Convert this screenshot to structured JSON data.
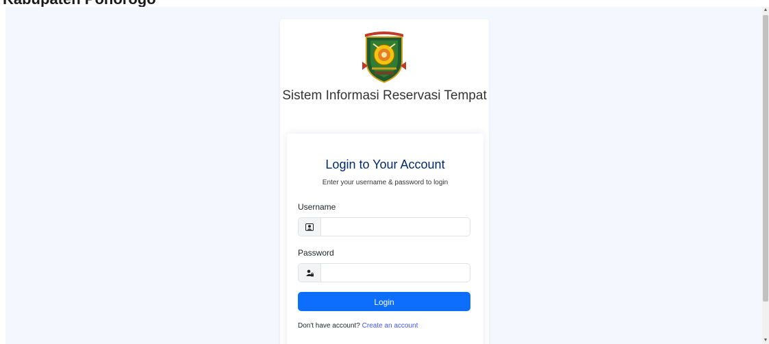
{
  "header": {
    "partial_text": "Kabupaten Ponorogo"
  },
  "brand": {
    "title": "Sistem Informasi Reservasi Tempat"
  },
  "login": {
    "title": "Login to Your Account",
    "subtitle": "Enter your username & password to login",
    "username_label": "Username",
    "username_value": "",
    "username_icon": "person-badge-icon",
    "password_label": "Password",
    "password_value": "",
    "password_icon": "person-lock-icon",
    "submit_label": "Login",
    "register_prompt": "Don't have account?",
    "register_link": "Create an account"
  },
  "colors": {
    "page_background": "#f4f7fd",
    "title_color": "#012970",
    "button_color": "#0d6efd",
    "link_color": "#4154f1"
  }
}
